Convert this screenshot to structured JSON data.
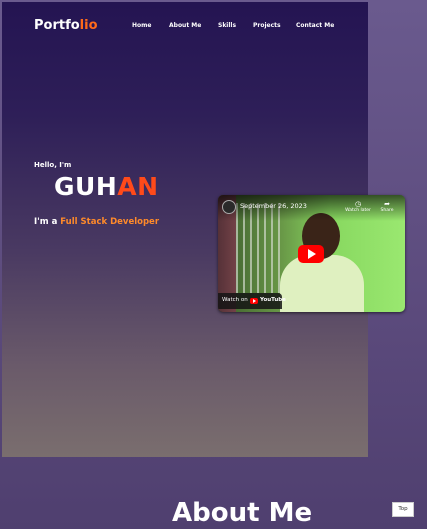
{
  "header": {
    "logo_main": "Portfo",
    "logo_accent": "lio",
    "nav": [
      "Home",
      "About Me",
      "Skills",
      "Projects",
      "Contact Me"
    ]
  },
  "hero": {
    "greeting": "Hello, I'm",
    "name_main": "GUH",
    "name_accent": "AN",
    "role_prefix": "I'm a",
    "role_accent": "Full Stack Developer"
  },
  "video": {
    "title": "September 26, 2023",
    "watch_later": "Watch later",
    "share": "Share",
    "watch_on": "Watch on",
    "youtube": "YouTube"
  },
  "about": {
    "title": "About Me"
  },
  "top_button": "Top",
  "colors": {
    "accent": "#ff6a1a",
    "hero_top": "#241452",
    "page_bg": "#5a4a7a"
  }
}
